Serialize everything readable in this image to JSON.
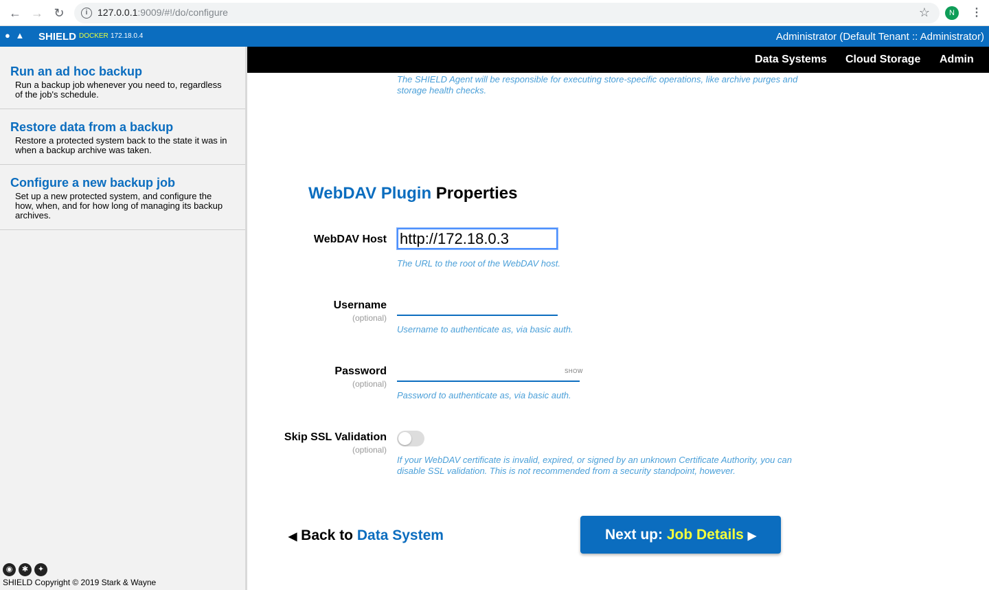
{
  "browser": {
    "url_host": "127.0.0.1",
    "url_rest": ":9009/#!/do/configure",
    "info_icon": "i",
    "profile_initial": "N"
  },
  "topbar": {
    "brand": "SHIELD",
    "env": "DOCKER",
    "ip": "172.18.0.4",
    "user": "Administrator (Default Tenant :: Administrator)"
  },
  "mainnav": {
    "items": [
      "Data Systems",
      "Cloud Storage",
      "Admin"
    ]
  },
  "sidebar": {
    "items": [
      {
        "title": "Run an ad hoc backup",
        "desc": "Run a backup job whenever you need to, regardless of the job's schedule."
      },
      {
        "title": "Restore data from a backup",
        "desc": "Restore a protected system back to the state it was in when a backup archive was taken."
      },
      {
        "title": "Configure a new backup job",
        "desc": "Set up a new protected system, and configure the how, when, and for how long of managing its backup archives."
      }
    ],
    "footer": "SHIELD Copyright © 2019 Stark & Wayne"
  },
  "content": {
    "intro_hint": "The SHIELD Agent will be responsible for executing store-specific operations, like archive purges and storage health checks.",
    "title_blue": "WebDAV Plugin",
    "title_rest": " Properties",
    "fields": {
      "host": {
        "label": "WebDAV Host",
        "value": "http://172.18.0.3",
        "hint": "The URL to the root of the WebDAV host."
      },
      "username": {
        "label": "Username",
        "optional": "(optional)",
        "value": "",
        "hint": "Username to authenticate as, via basic auth."
      },
      "password": {
        "label": "Password",
        "optional": "(optional)",
        "value": "",
        "show": "SHOW",
        "hint": "Password to authenticate as, via basic auth."
      },
      "ssl": {
        "label": "Skip SSL Validation",
        "optional": "(optional)",
        "enabled": false,
        "hint": "If your WebDAV certificate is invalid, expired, or signed by an unknown Certificate Authority, you can disable SSL validation. This is not recommended from a security standpoint, however."
      }
    },
    "back": {
      "prefix": "Back to ",
      "link": "Data System"
    },
    "next": {
      "prefix": "Next up: ",
      "link": "Job Details"
    }
  }
}
